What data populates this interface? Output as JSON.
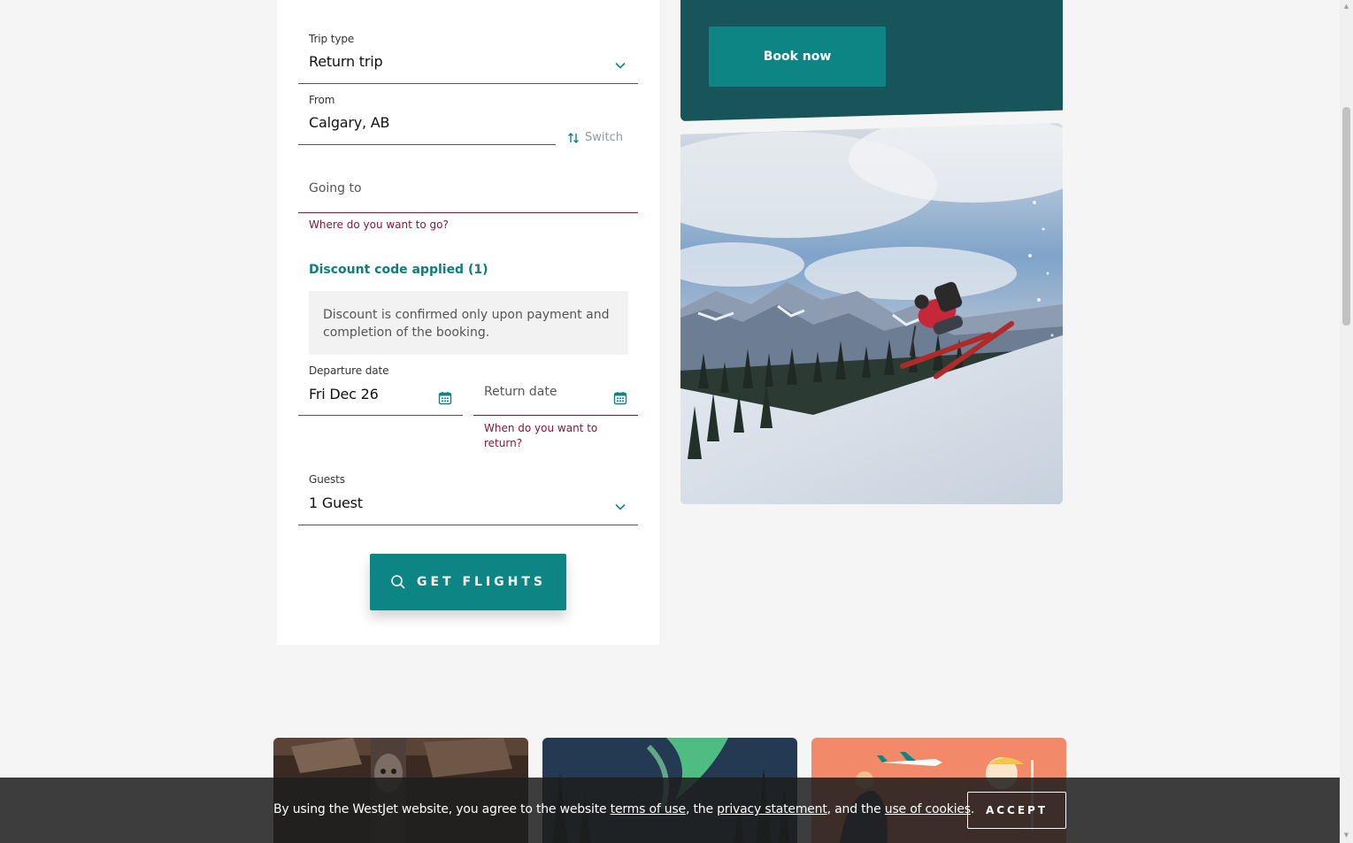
{
  "form": {
    "trip_type": {
      "label": "Trip type",
      "value": "Return trip"
    },
    "from": {
      "label": "From",
      "value": "Calgary, AB"
    },
    "switch_label": "Switch",
    "going_to": {
      "placeholder": "Going to",
      "error": "Where do you want to go?"
    },
    "discount": {
      "link": "Discount code applied (1)",
      "note": "Discount is confirmed only upon payment and completion of the booking."
    },
    "departure": {
      "label": "Departure date",
      "value": "Fri Dec 26"
    },
    "return": {
      "placeholder": "Return date",
      "error_line1": "When do you want to",
      "error_line2": "return?"
    },
    "guests": {
      "label": "Guests",
      "value": "1 Guest"
    },
    "submit_label": "GET FLIGHTS"
  },
  "promo": {
    "book_label": "Book now"
  },
  "cookie": {
    "text1": "By using the WestJet website, you agree to the website ",
    "link_terms": "terms of use",
    "text2": ", the ",
    "link_privacy": "privacy statement",
    "text3": ", and the ",
    "link_cookies": "use of cookies",
    "text4": ".",
    "accept_label": "ACCEPT"
  },
  "colors": {
    "accent": "#0e8585",
    "promo_panel": "#17555a",
    "error": "#8a1538"
  },
  "icons": [
    "chevron-down-icon",
    "switch-icon",
    "calendar-icon",
    "search-icon"
  ]
}
